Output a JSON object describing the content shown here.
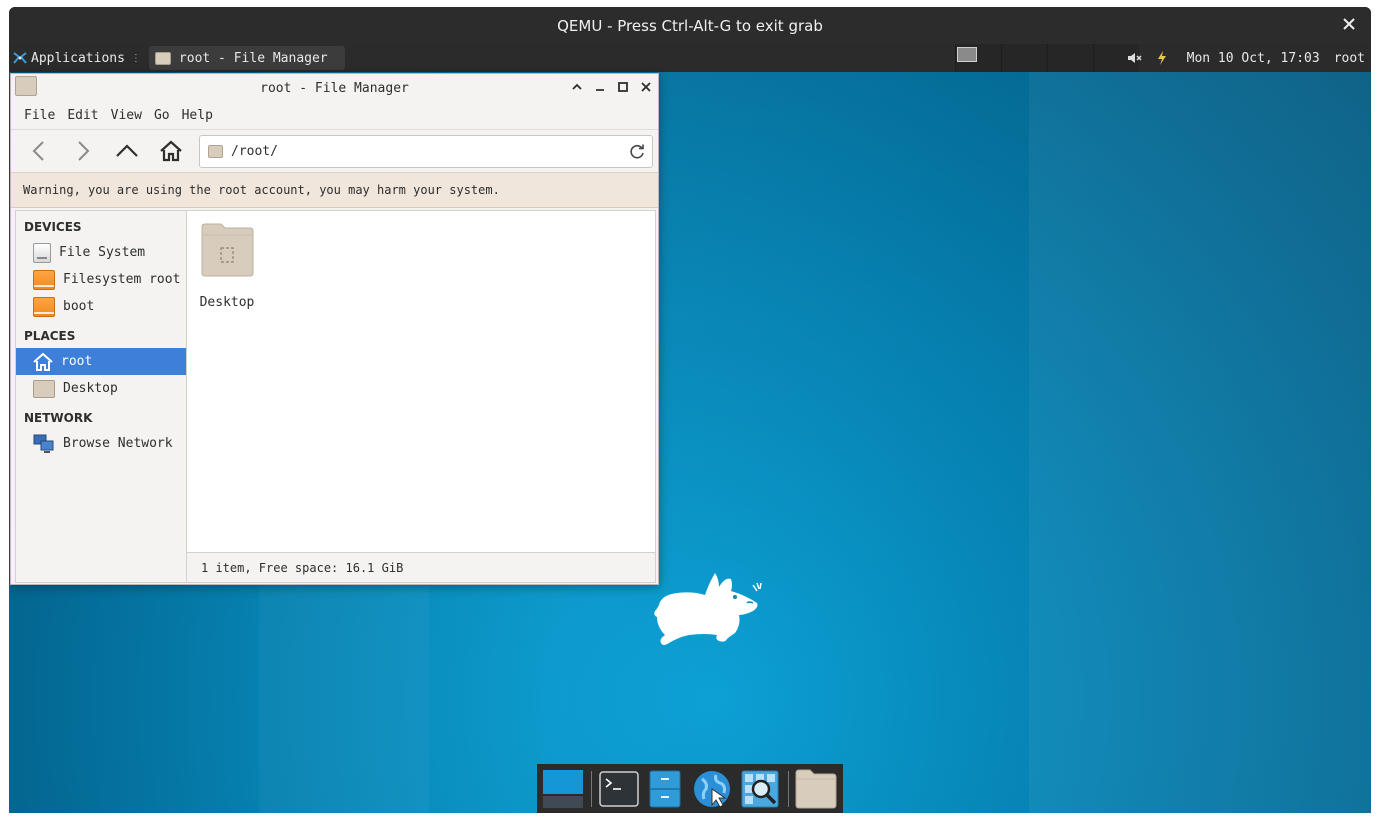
{
  "qemu": {
    "title": "QEMU - Press Ctrl-Alt-G to exit grab",
    "close_glyph": "✕"
  },
  "panel": {
    "applications_label": "Applications",
    "task_label": "root - File Manager",
    "clock": "Mon 10 Oct, 17:03",
    "user": "root",
    "tray_icons": [
      "volume-muted-icon",
      "power-icon"
    ]
  },
  "file_manager": {
    "title": "root - File Manager",
    "menu": [
      "File",
      "Edit",
      "View",
      "Go",
      "Help"
    ],
    "location": "/root/",
    "warning": "Warning, you are using the root account, you may harm your system.",
    "sidebar": {
      "devices_header": "DEVICES",
      "devices": [
        "File System",
        "Filesystem root",
        "boot"
      ],
      "places_header": "PLACES",
      "places": [
        "root",
        "Desktop"
      ],
      "selected_place": "root",
      "network_header": "NETWORK",
      "network": [
        "Browse Network"
      ]
    },
    "items": [
      {
        "name": "Desktop",
        "icon": "folder-desktop-icon"
      }
    ],
    "status": "1 item, Free space: 16.1 GiB"
  },
  "dock": {
    "items": [
      "show-desktop-icon",
      "terminal-icon",
      "file-manager-icon",
      "web-browser-icon",
      "app-finder-icon",
      "home-folder-icon"
    ]
  },
  "colors": {
    "accent": "#3d7fd9",
    "panel": "#2b2b2b",
    "warning_bg": "#f1e6dc",
    "desktop": "#0686b6"
  }
}
